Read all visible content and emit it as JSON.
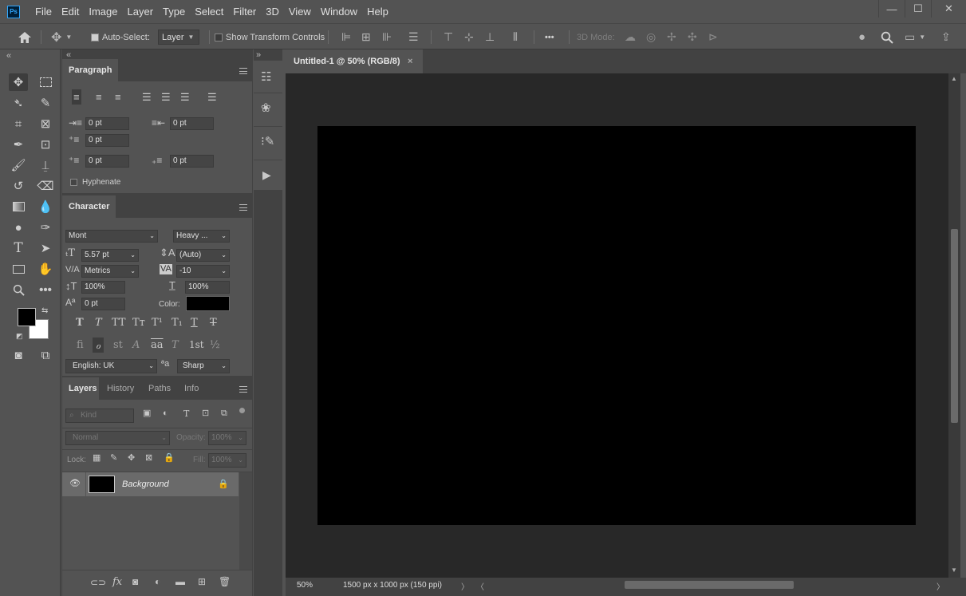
{
  "app": {
    "logo": "Ps"
  },
  "menu": [
    "File",
    "Edit",
    "Image",
    "Layer",
    "Type",
    "Select",
    "Filter",
    "3D",
    "View",
    "Window",
    "Help"
  ],
  "window_controls": {
    "minimize": "—",
    "maximize": "☐",
    "close": "✕"
  },
  "options_bar": {
    "auto_select_label": "Auto-Select:",
    "auto_select_checked": true,
    "auto_select_target": "Layer",
    "show_transform_label": "Show Transform Controls",
    "show_transform_checked": false,
    "more_label": "•••",
    "mode_3d_label": "3D Mode:"
  },
  "collapse_left": "«",
  "collapse_right": "»",
  "paragraph": {
    "tab": "Paragraph",
    "indent_left": "0 pt",
    "indent_right": "0 pt",
    "indent_first": "0 pt",
    "space_before": "0 pt",
    "space_after": "0 pt",
    "hyphenate_label": "Hyphenate"
  },
  "character": {
    "tab": "Character",
    "font_family": "Mont",
    "font_style": "Heavy ...",
    "font_size": "5.57 pt",
    "leading": "(Auto)",
    "kerning": "Metrics",
    "tracking": "-10",
    "vertical_scale": "100%",
    "horizontal_scale": "100%",
    "baseline_shift": "0 pt",
    "color_label": "Color:",
    "color": "#000000",
    "language": "English: UK",
    "antialias_icon": "ªa",
    "antialias": "Sharp",
    "style_buttons": [
      "T",
      "T",
      "TT",
      "Tт",
      "T¹",
      "T₁",
      "T",
      "T"
    ],
    "opentype_buttons": [
      "fi",
      "ℴ",
      "st",
      "A",
      "aa",
      "T",
      "1st",
      "½"
    ]
  },
  "layers": {
    "tabs": [
      "Layers",
      "History",
      "Paths",
      "Info"
    ],
    "filter_placeholder": "Kind",
    "blend_mode": "Normal",
    "opacity_label": "Opacity:",
    "opacity": "100%",
    "lock_label": "Lock:",
    "fill_label": "Fill:",
    "fill": "100%",
    "items": [
      {
        "name": "Background",
        "visible": true,
        "locked": true
      }
    ]
  },
  "document": {
    "tab_title": "Untitled-1 @ 50% (RGB/8)",
    "close": "×",
    "zoom": "50%",
    "info": "1500 px x 1000 px (150 ppi)",
    "fill_color": "#000000"
  },
  "colors": {
    "foreground": "#000000",
    "background": "#ffffff",
    "accent": "#31a8ff"
  }
}
